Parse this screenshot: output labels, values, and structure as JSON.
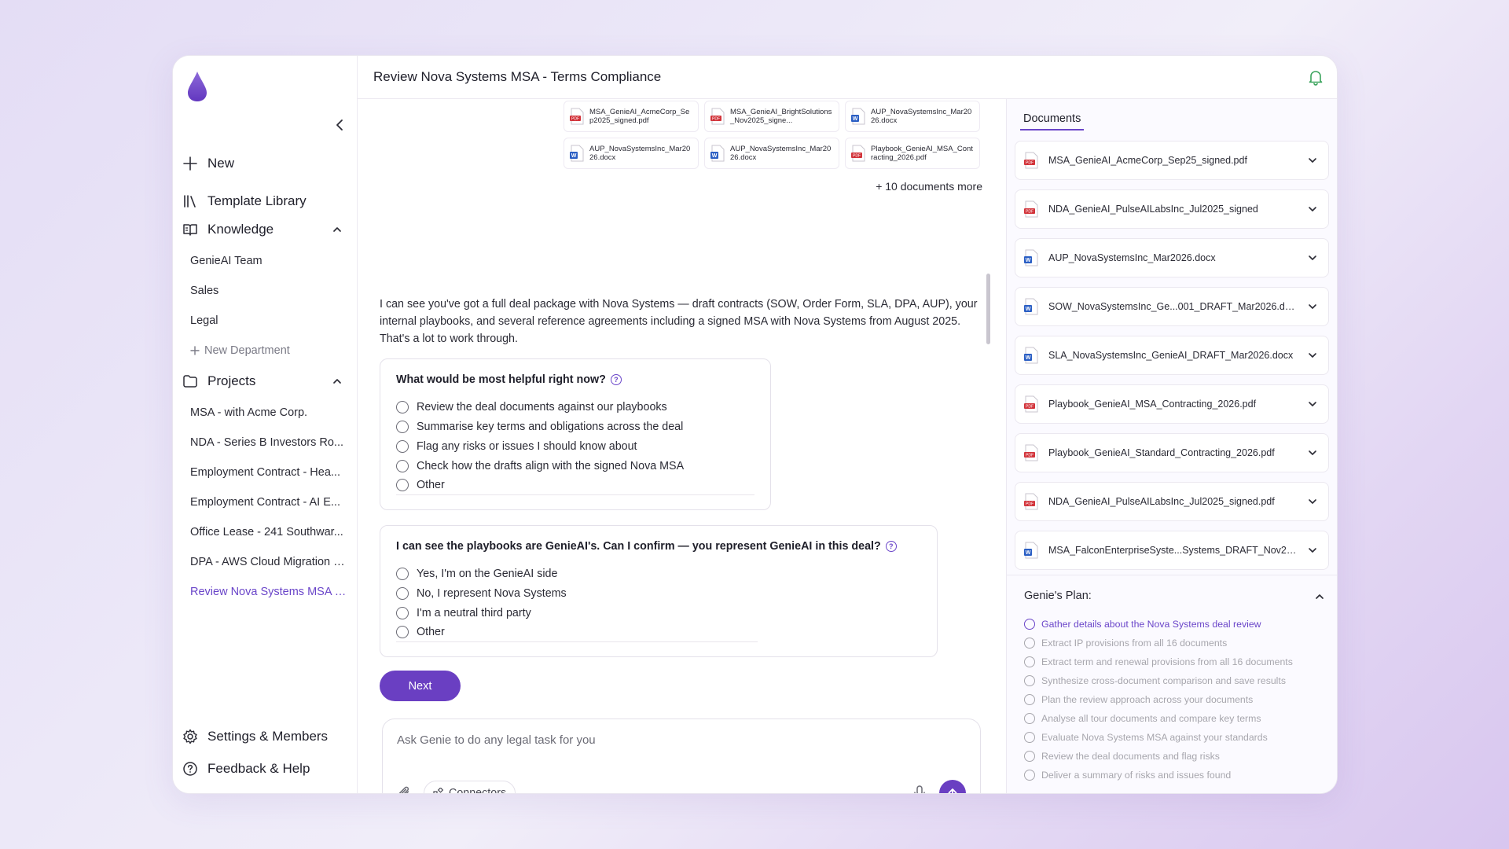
{
  "header": {
    "title": "Review Nova Systems MSA - Terms Compliance"
  },
  "sidebar": {
    "new_label": "New",
    "template_library_label": "Template Library",
    "knowledge_label": "Knowledge",
    "knowledge_items": [
      "GenieAI Team",
      "Sales",
      "Legal"
    ],
    "new_department_label": "New Department",
    "projects_label": "Projects",
    "project_items": [
      "MSA - with Acme Corp.",
      "NDA - Series B Investors Ro...",
      "Employment Contract - Hea...",
      "Employment Contract - AI E...",
      "Office Lease - 241 Southwar...",
      "DPA - AWS Cloud Migration P...",
      "Review Nova Systems MSA - T..."
    ],
    "settings_label": "Settings & Members",
    "feedback_label": "Feedback & Help"
  },
  "chat": {
    "attached_files": [
      {
        "name": "MSA_GenieAI_AcmeCorp_Sep2025_signed.pdf",
        "type": "pdf"
      },
      {
        "name": "MSA_GenieAI_BrightSolutions_Nov2025_signe...",
        "type": "pdf"
      },
      {
        "name": "AUP_NovaSystemsInc_Mar2026.docx",
        "type": "docx"
      },
      {
        "name": "AUP_NovaSystemsInc_Mar2026.docx",
        "type": "docx"
      },
      {
        "name": "AUP_NovaSystemsInc_Mar2026.docx",
        "type": "docx"
      },
      {
        "name": "Playbook_GenieAI_MSA_Contracting_2026.pdf",
        "type": "pdf"
      }
    ],
    "more_docs": "+ 10 documents more",
    "message": "I can see you've got a full deal package with Nova Systems — draft contracts (SOW, Order Form, SLA, DPA, AUP), your internal playbooks, and several reference agreements including a signed MSA with Nova Systems from August 2025. That's a lot to work through.",
    "q1": {
      "title": "What would be most helpful right now?",
      "options": [
        "Review the deal documents against our playbooks",
        "Summarise key terms and obligations across the deal",
        "Flag any risks or issues I should know about",
        "Check how the drafts align with the signed Nova MSA",
        "Other"
      ]
    },
    "q2": {
      "title": "I can see the playbooks are GenieAI's. Can I confirm — you represent GenieAI in this deal?",
      "options": [
        "Yes, I'm on the GenieAI side",
        "No, I represent Nova Systems",
        "I'm a neutral third party",
        "Other"
      ]
    },
    "next_label": "Next",
    "composer_placeholder": "Ask Genie to do any legal task for you",
    "connectors_label": "Connectors"
  },
  "documents": {
    "tab_label": "Documents",
    "items": [
      {
        "name": "MSA_GenieAI_AcmeCorp_Sep25_signed.pdf",
        "type": "pdf"
      },
      {
        "name": "NDA_GenieAI_PulseAILabsInc_Jul2025_signed",
        "type": "pdf"
      },
      {
        "name": "AUP_NovaSystemsInc_Mar2026.docx",
        "type": "docx"
      },
      {
        "name": "SOW_NovaSystemsInc_Ge...001_DRAFT_Mar2026.docx",
        "type": "docx"
      },
      {
        "name": "SLA_NovaSystemsInc_GenieAI_DRAFT_Mar2026.docx",
        "type": "docx"
      },
      {
        "name": "Playbook_GenieAI_MSA_Contracting_2026.pdf",
        "type": "pdf"
      },
      {
        "name": "Playbook_GenieAI_Standard_Contracting_2026.pdf",
        "type": "pdf"
      },
      {
        "name": "NDA_GenieAI_PulseAILabsInc_Jul2025_signed.pdf",
        "type": "pdf"
      },
      {
        "name": "MSA_FalconEnterpriseSyste...Systems_DRAFT_Nov25.docx",
        "type": "docx"
      }
    ]
  },
  "plan": {
    "title": "Genie's Plan:",
    "steps": [
      "Gather details about the Nova Systems deal review",
      "Extract IP provisions from all 16 documents",
      "Extract term and renewal provisions from all 16 documents",
      "Synthesize cross-document comparison and save results",
      "Plan the review approach across your documents",
      "Analyse all tour documents and compare key terms",
      "Evaluate Nova Systems MSA against your standards",
      "Review the deal documents and flag risks",
      "Deliver a summary of risks and issues found"
    ]
  },
  "colors": {
    "accent": "#6a3fc2",
    "pdf_red": "#d2333a",
    "word_blue": "#2b5fc4"
  }
}
